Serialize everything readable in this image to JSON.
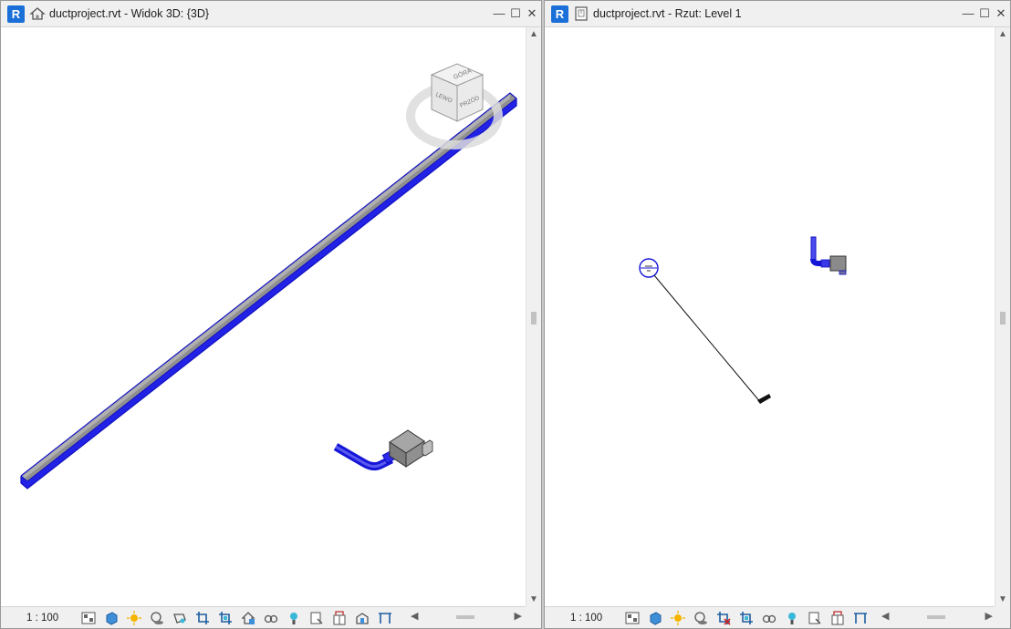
{
  "left_view": {
    "app_badge": "R",
    "view_type_icon": "home-3d-icon",
    "title": "ductproject.rvt - Widok 3D: {3D}",
    "scale": "1 : 100",
    "viewcube": {
      "top": "GÓRA",
      "left": "LEWO",
      "front": "PRZÓD"
    }
  },
  "right_view": {
    "app_badge": "R",
    "view_type_icon": "floor-plan-icon",
    "title": "ductproject.rvt - Rzut: Level 1",
    "scale": "1 : 100"
  },
  "window_controls": {
    "minimize": "—",
    "restore": "☐",
    "close": "✕"
  },
  "colors": {
    "duct_blue": "#1f1fe0",
    "duct_gray": "#8a8a8a",
    "badge_blue": "#1a6fd8"
  }
}
